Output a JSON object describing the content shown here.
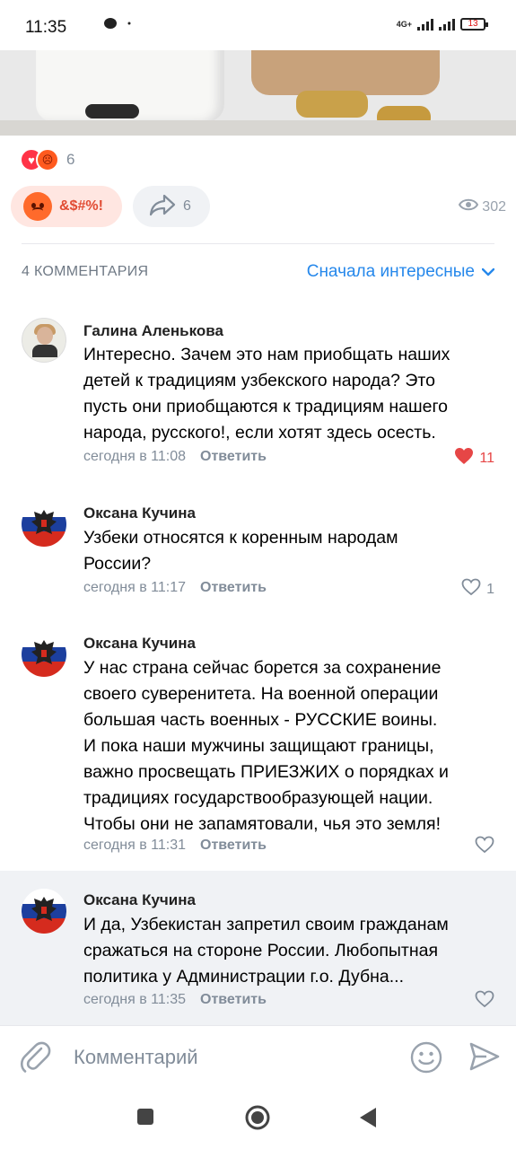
{
  "status_bar": {
    "time": "11:35",
    "network": "4G+",
    "battery": "13"
  },
  "post": {
    "reactions_count": "6",
    "my_reaction_label": "&$#%!",
    "shares_count": "6",
    "views_count": "302"
  },
  "comments_section": {
    "count_label": "4 КОММЕНТАРИЯ",
    "sort_label": "Сначала интересные",
    "reply_label": "Ответить"
  },
  "comments": [
    {
      "author": "Галина Аленькова",
      "text": "Интересно. Зачем это нам приобщать наших\nдетей к традициям узбекского народа? Это\nпусть они приобщаются к традициям нашего\nнарода, русского!, если хотят здесь осесть.",
      "time": "сегодня в 11:08",
      "likes": "11",
      "liked": true
    },
    {
      "author": "Оксана Кучина",
      "text": "Узбеки относятся к коренным народам\nРоссии?",
      "time": "сегодня в 11:17",
      "likes": "1",
      "liked": false
    },
    {
      "author": "Оксана Кучина",
      "text": "У нас страна сейчас борется за сохранение\nсвоего суверенитета. На военной операции\nбольшая часть военных - РУССКИЕ воины.\nИ пока наши мужчины защищают границы,\nважно просвещать ПРИЕЗЖИХ о порядках и\nтрадициях государствообразующей нации.\nЧтобы они не запамятовали, чья это земля!",
      "time": "сегодня в 11:31",
      "likes": "",
      "liked": false
    },
    {
      "author": "Оксана Кучина",
      "text": "И да, Узбекистан запретил своим гражданам\nсражаться на стороне России. Любопытная\nполитика у Администрации г.о. Дубна...",
      "time": "сегодня в 11:35",
      "likes": "",
      "liked": false
    }
  ],
  "composer": {
    "placeholder": "Комментарий"
  },
  "icons": {
    "heart": "heart-icon",
    "angry": "angry-face-icon",
    "share": "share-arrow-icon",
    "views": "eye-icon",
    "attach": "paperclip-icon",
    "emoji": "smiley-icon",
    "send": "send-icon"
  },
  "colors": {
    "accent": "#2688eb",
    "like": "#e64646",
    "secondary_text": "#818c99",
    "reaction_bg": "#ffe6e1",
    "highlight_bg": "#f0f2f5"
  }
}
